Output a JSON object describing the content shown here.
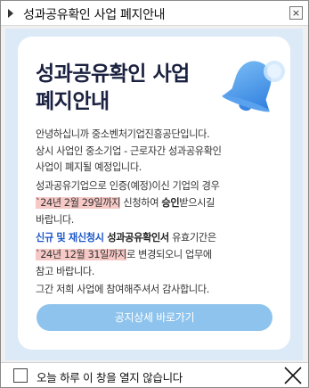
{
  "window": {
    "title": "성과공유확인 사업 폐지안내",
    "close_glyph": "×"
  },
  "notice": {
    "headline_line1": "성과공유확인 사업",
    "headline_line2": "폐지안내",
    "bell_icon": "bell-icon",
    "p1_line1": "안녕하십니까 중소벤처기업진흥공단입니다.",
    "p1_line2": "상시 사업인 중소기업 - 근로자간 성과공유확인",
    "p1_line3": "사업이 폐지될 예정입니다.",
    "p2_line1": "성과공유기업으로 인증(예정)이신 기업의 경우",
    "p2_highlight": "`24년 2월 29일까지",
    "p2_mid": " 신청하여 ",
    "p2_bold": "승인",
    "p2_end": "받으시길",
    "p2_line3": "바랍니다.",
    "p3_blue": "신규 및 재신청시",
    "p3_bold": " 성과공유확인서",
    "p3_end": " 유효기간은",
    "p3_highlight": "`24년 12월 31일까지",
    "p3_rest": "로 변경되오니 업무에",
    "p3_line3": "참고 바랍니다.",
    "p4": "그간 저희 사업에 참여해주셔서 감사합니다.",
    "cta_label": "공지상세 바로가기",
    "colors": {
      "highlight": "#f6c9c6",
      "accent_blue": "#1c57c9",
      "button": "#8dc3ec",
      "background": "#dceaf7"
    }
  },
  "footer": {
    "dont_show_label": "오늘 하루 이 창을 열지 않습니다",
    "close_icon": "close-icon"
  }
}
